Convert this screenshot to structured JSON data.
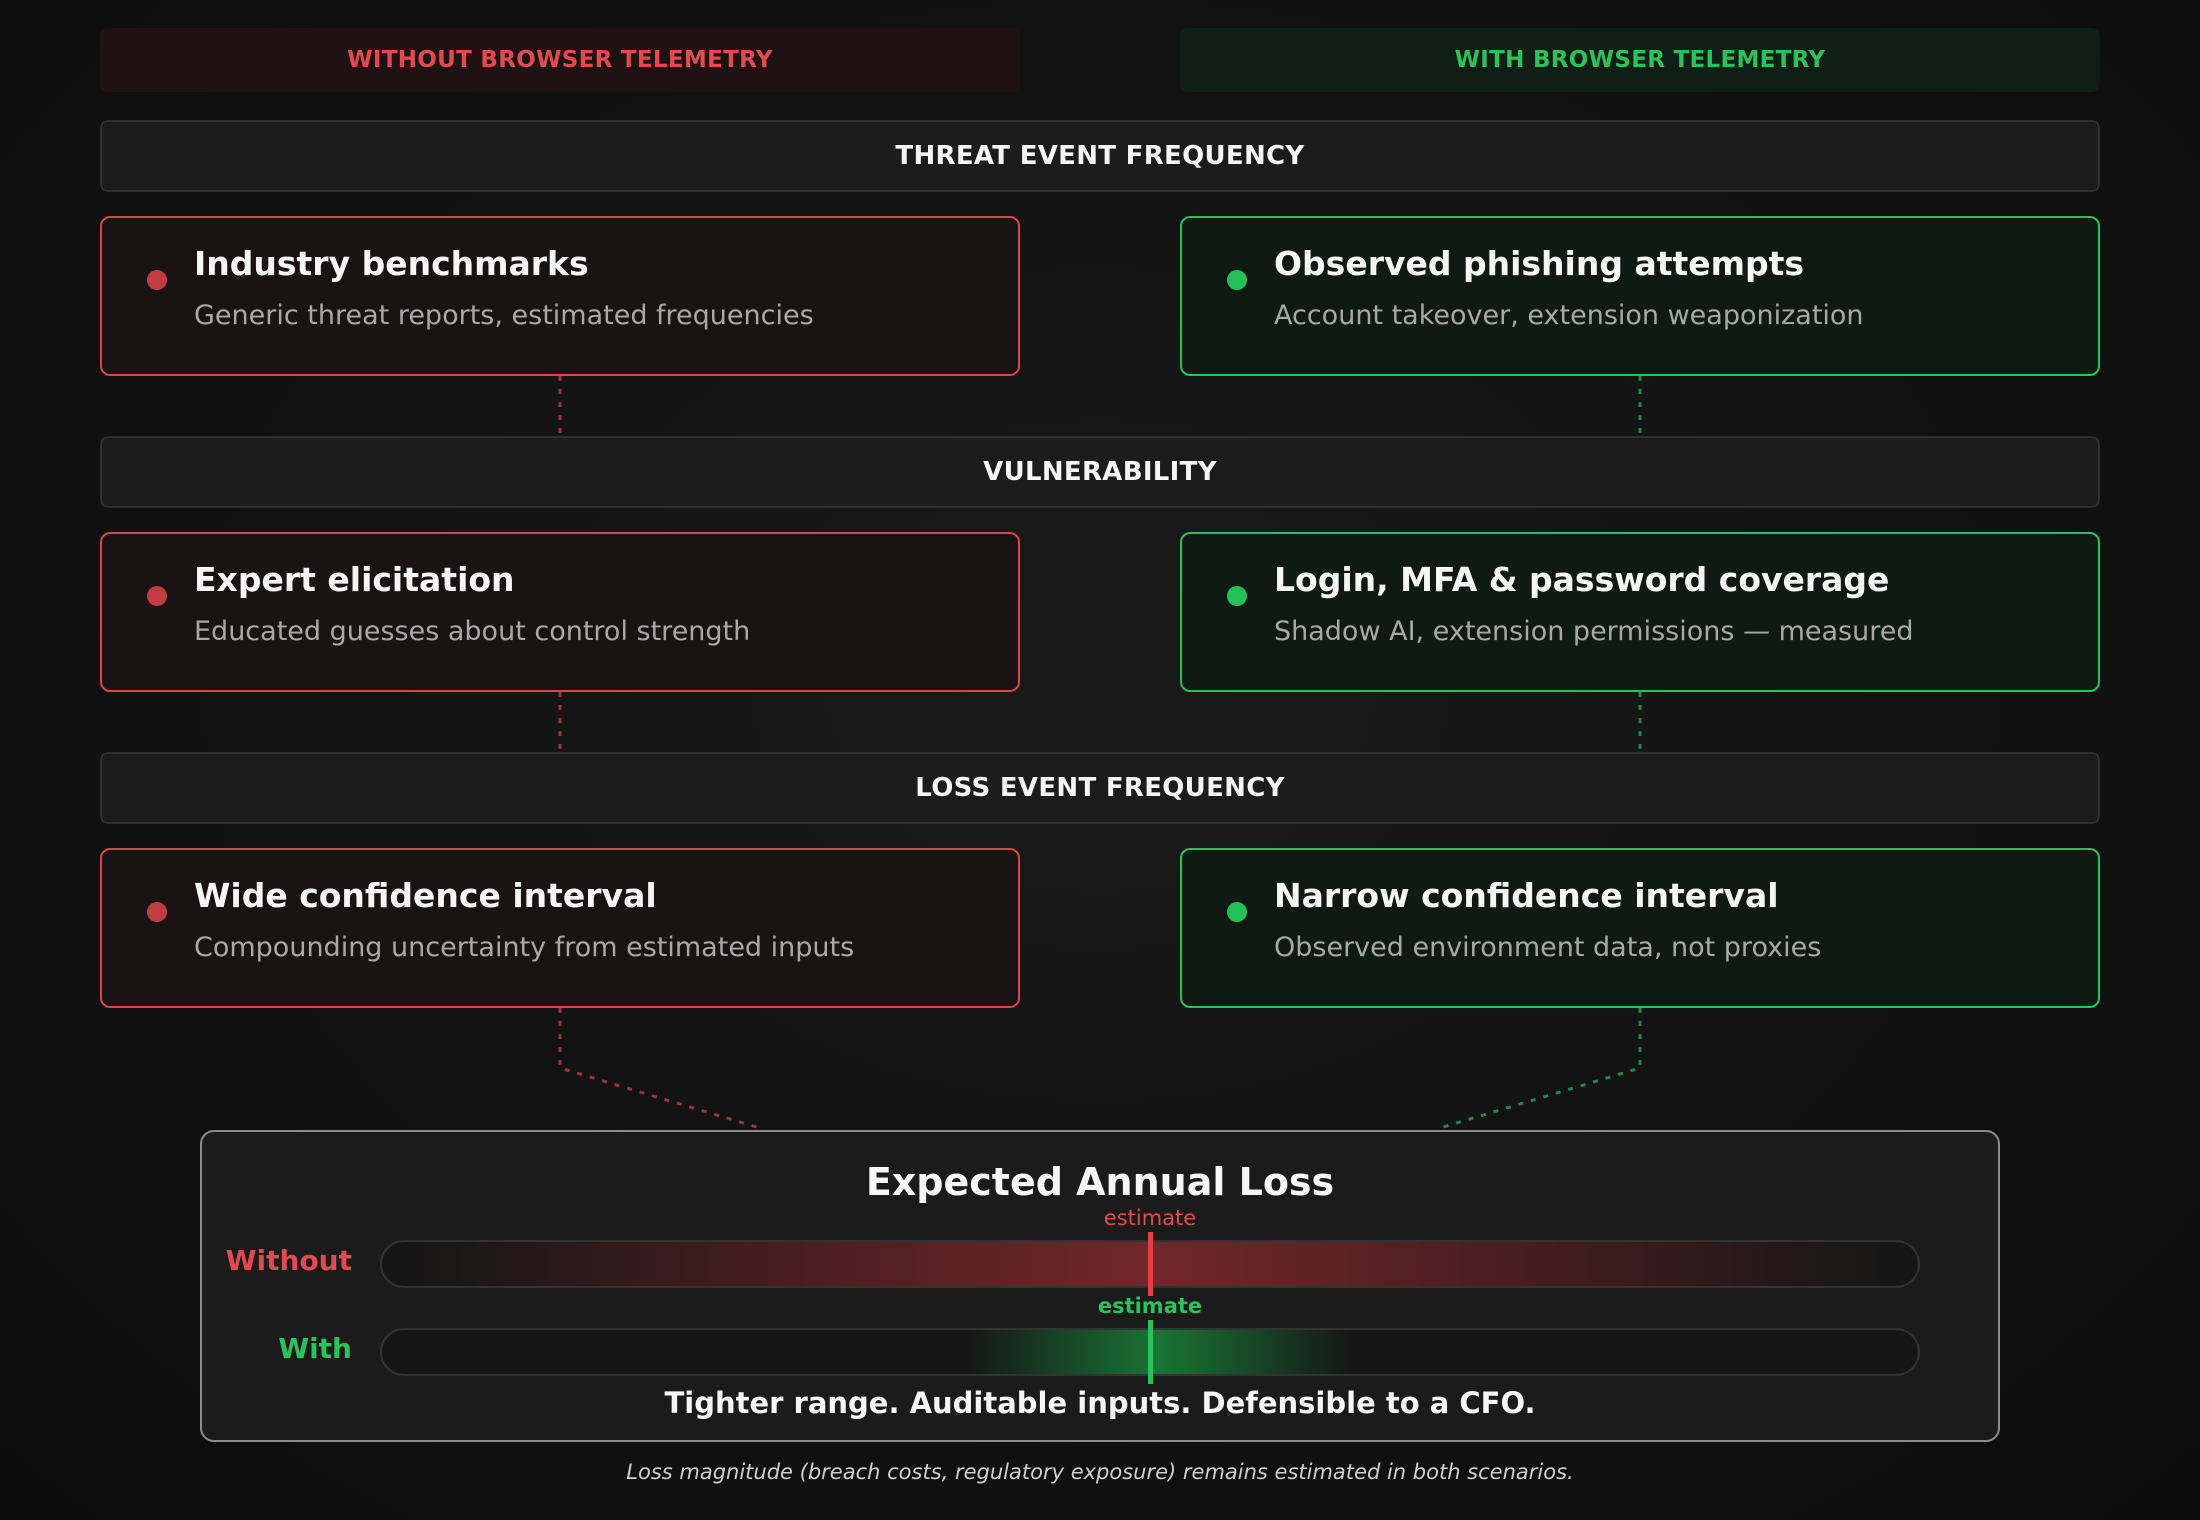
{
  "columns": {
    "without": "WITHOUT BROWSER TELEMETRY",
    "with": "WITH BROWSER TELEMETRY"
  },
  "sections": [
    {
      "label": "THREAT EVENT FREQUENCY",
      "without": {
        "title": "Industry benchmarks",
        "subtitle": "Generic threat reports, estimated frequencies"
      },
      "with": {
        "title": "Observed phishing attempts",
        "subtitle": "Account takeover, extension weaponization"
      }
    },
    {
      "label": "VULNERABILITY",
      "without": {
        "title": "Expert elicitation",
        "subtitle": "Educated guesses about control strength"
      },
      "with": {
        "title": "Login, MFA & password coverage",
        "subtitle": "Shadow AI, extension permissions — measured"
      }
    },
    {
      "label": "LOSS EVENT FREQUENCY",
      "without": {
        "title": "Wide confidence interval",
        "subtitle": "Compounding uncertainty from estimated inputs"
      },
      "with": {
        "title": "Narrow confidence interval",
        "subtitle": "Observed environment data, not proxies"
      }
    }
  ],
  "summary": {
    "title": "Expected Annual Loss",
    "without_label": "Without",
    "with_label": "With",
    "estimate_label": "estimate",
    "tagline": "Tighter range. Auditable inputs. Defensible to a CFO.",
    "without_range": {
      "start": 0.0,
      "end": 1.0,
      "estimate": 0.5
    },
    "with_range": {
      "start": 0.38,
      "end": 0.63,
      "estimate": 0.5
    }
  },
  "footnote": "Loss magnitude (breach costs, regulatory exposure) remains estimated in both scenarios.",
  "colors": {
    "red": "#e24a4f",
    "green": "#2bc25c"
  }
}
